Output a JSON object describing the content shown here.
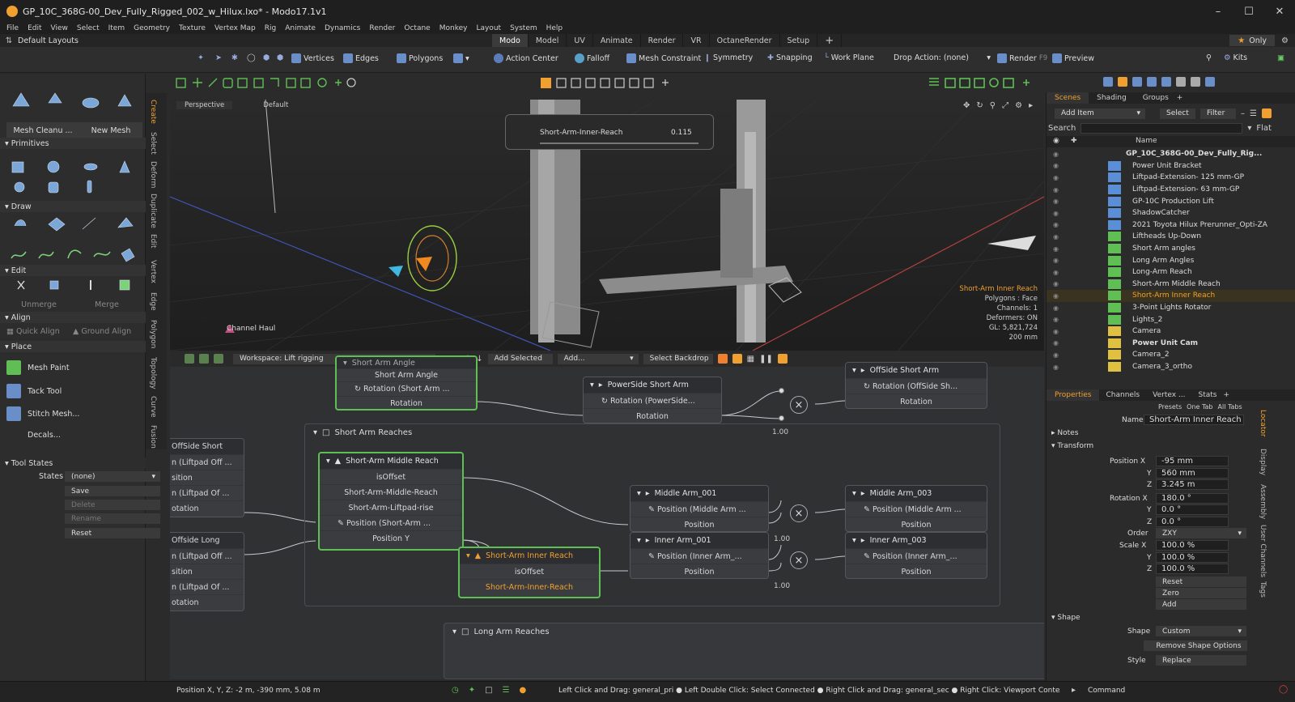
{
  "titlebar": {
    "title": "GP_10C_368G-00_Dev_Fully_Rigged_002_w_Hilux.lxo* - Modo17.1v1"
  },
  "menu": [
    "File",
    "Edit",
    "View",
    "Select",
    "Item",
    "Geometry",
    "Texture",
    "Vertex Map",
    "Rig",
    "Animate",
    "Dynamics",
    "Render",
    "Octane",
    "Monkey",
    "Layout",
    "System",
    "Help"
  ],
  "layoutbar": {
    "preset": "Default Layouts",
    "tabs": [
      "Modo",
      "Model",
      "UV",
      "Animate",
      "Render",
      "VR",
      "OctaneRender",
      "Setup"
    ],
    "add": "+",
    "only": "Only"
  },
  "toolbar": {
    "vertices": "Vertices",
    "edges": "Edges",
    "polygons": "Polygons",
    "action_center": "Action Center",
    "falloff": "Falloff",
    "mesh_constraint": "Mesh Constraint",
    "symmetry": "Symmetry",
    "snapping": "Snapping",
    "work_plane": "Work Plane",
    "drop_action": "Drop Action: (none)",
    "render": "Render",
    "render_key": "F9",
    "preview": "Preview",
    "kits": "Kits"
  },
  "leftpanel": {
    "mesh_cleanup": "Mesh Cleanu ...",
    "new_mesh": "New Mesh",
    "primitives": "Primitives",
    "draw": "Draw",
    "edit": "Edit",
    "unmerge": "Unmerge",
    "merge": "Merge",
    "align": "Align",
    "quick_align": "Quick Align",
    "ground_align": "Ground Align",
    "place": "Place",
    "mesh_paint": "Mesh Paint",
    "tack_tool": "Tack Tool",
    "stitch_mesh": "Stitch Mesh...",
    "decals": "Decals...",
    "tool_states": "Tool States",
    "states_label": "States",
    "states_value": "(none)",
    "save": "Save",
    "delete": "Delete",
    "rename": "Rename",
    "reset": "Reset"
  },
  "lefttabs": [
    "Create",
    "Select",
    "Deform",
    "Duplicate",
    "Edit",
    "Vertex",
    "Edge",
    "Polygon",
    "Topology",
    "Curve",
    "Fusion"
  ],
  "viewport": {
    "view": "Perspective",
    "shading": "Default",
    "channel_haul": "Channel Haul",
    "slider_label": "Short-Arm-Inner-Reach",
    "slider_value": "0.115",
    "info_title": "Short-Arm Inner Reach",
    "info_lines": [
      "Polygons : Face",
      "Channels: 1",
      "Deformers: ON",
      "GL: 5,821,724",
      "200 mm"
    ]
  },
  "schematic": {
    "workspace": "Workspace: Lift rigging",
    "add_selected": "Add Selected",
    "add": "Add...",
    "select_backdrop": "Select Backdrop",
    "short_arm_node": {
      "title": "Short Arm Angle",
      "row1": "Short Arm Angle",
      "row2": "Rotation (Short Arm ...",
      "row3": "Rotation"
    },
    "powerside": {
      "title": "PowerSide Short Arm",
      "row1": "Rotation (PowerSide...",
      "row2": "Rotation"
    },
    "offside": {
      "title": "OffSide Short Arm",
      "row1": "Rotation (OffSide Sh...",
      "row2": "Rotation"
    },
    "mult_value": "1.00",
    "group_reaches": "Short Arm Reaches",
    "group_long": "Long Arm Reaches",
    "left_nodes": [
      "OffSide Short",
      "n (Liftpad Off ...",
      "sition",
      "n (Liftpad Of ...",
      "otation",
      "Offside Long",
      "n (Liftpad Off ...",
      "sition",
      "n (Liftpad Of ...",
      "otation"
    ],
    "middle_reach": {
      "title": "Short-Arm Middle Reach",
      "rows": [
        "isOffset",
        "Short-Arm-Middle-Reach",
        "Short-Arm-Liftpad-rise",
        "Position (Short-Arm ...",
        "Position Y"
      ]
    },
    "inner_reach": {
      "title": "Short-Arm Inner Reach",
      "rows": [
        "isOffset",
        "Short-Arm-Inner-Reach"
      ]
    },
    "middle_arm_001": {
      "title": "Middle Arm_001",
      "row1": "Position (Middle Arm ...",
      "row2": "Position"
    },
    "inner_arm_001": {
      "title": "Inner Arm_001",
      "row1": "Position (Inner Arm_...",
      "row2": "Position"
    },
    "middle_arm_003": {
      "title": "Middle Arm_003",
      "row1": "Position (Middle Arm ...",
      "row2": "Position"
    },
    "inner_arm_003": {
      "title": "Inner Arm_003",
      "row1": "Position (Inner Arm_...",
      "row2": "Position"
    }
  },
  "scenes": {
    "tabs": [
      "Scenes",
      "Shading",
      "Groups"
    ],
    "add_item": "Add Item",
    "select": "Select",
    "filter": "Filter",
    "search": "Search",
    "flat": "Flat",
    "name_col": "Name",
    "items": [
      {
        "name": "GP_10C_368G-00_Dev_Fully_Rig...",
        "bold": true
      },
      {
        "name": "Power Unit Bracket"
      },
      {
        "name": "Liftpad-Extension- 125 mm-GP"
      },
      {
        "name": "Liftpad-Extension- 63 mm-GP"
      },
      {
        "name": "GP-10C Production Lift"
      },
      {
        "name": "ShadowCatcher"
      },
      {
        "name": "2021 Toyota Hilux Prerunner_Opti-ZA"
      },
      {
        "name": "Liftheads Up-Down"
      },
      {
        "name": "Short Arm angles"
      },
      {
        "name": "Long Arm Angles"
      },
      {
        "name": "Long-Arm Reach"
      },
      {
        "name": "Short-Arm Middle Reach"
      },
      {
        "name": "Short-Arm Inner Reach",
        "highlight": true
      },
      {
        "name": "3-Point Lights Rotator"
      },
      {
        "name": "Lights_2"
      },
      {
        "name": "Camera"
      },
      {
        "name": "Power Unit Cam",
        "bold": true
      },
      {
        "name": "Camera_2"
      },
      {
        "name": "Camera_3_ortho"
      }
    ]
  },
  "properties": {
    "tabs": [
      "Properties",
      "Channels",
      "Vertex ...",
      "Stats"
    ],
    "presets": "Presets",
    "one_tab": "One Tab",
    "all_tabs": "All Tabs",
    "name_label": "Name",
    "name_value": "Short-Arm Inner Reach",
    "notes": "Notes",
    "transform": "Transform",
    "position_label": "Position X",
    "pos_x": "-95 mm",
    "pos_y": "560 mm",
    "pos_z": "3.245 m",
    "rotation_label": "Rotation X",
    "rot_x": "180.0 °",
    "rot_y": "0.0 °",
    "rot_z": "0.0 °",
    "order_label": "Order",
    "order_value": "ZXY",
    "scale_label": "Scale X",
    "scale_x": "100.0 %",
    "scale_y": "100.0 %",
    "scale_z": "100.0 %",
    "y": "Y",
    "z": "Z",
    "reset": "Reset",
    "zero": "Zero",
    "add": "Add",
    "shape_section": "Shape",
    "shape_label": "Shape",
    "shape_value": "Custom",
    "remove_shape": "Remove Shape Options",
    "style_label": "Style",
    "style_value": "Replace",
    "side_tabs": [
      "Locator",
      "Display",
      "Assembly",
      "User Channels",
      "Tags"
    ]
  },
  "statusbar": {
    "position": "Position X, Y, Z:  -2 m, -390 mm, 5.08 m",
    "hint": "Left Click and Drag: general_pri ● Left Double Click: Select Connected ● Right Click and Drag: general_sec ● Right Click: Viewport Context Menu (pop ...",
    "command": "Command"
  },
  "colors": {
    "accent": "#f0a030",
    "selected_green": "#5fbf55",
    "highlight_text": "#f0a030"
  }
}
